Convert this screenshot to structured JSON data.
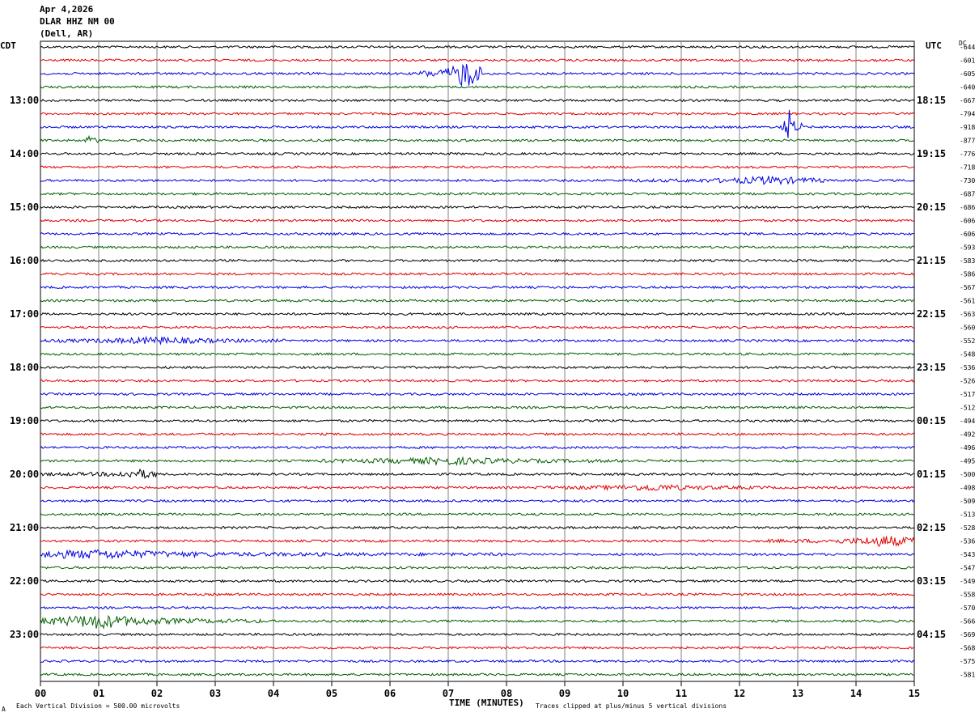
{
  "header": {
    "date": "Apr 4,2026",
    "station": "DLAR HHZ NM 00",
    "location": "(Dell, AR)"
  },
  "left_axis_label": "CDT",
  "right_axis_label": "UTC",
  "dc_label": "DC",
  "footer": {
    "x_axis_title": "TIME (MINUTES)",
    "scale_note": "Each Vertical Division =  500.00 microvolts",
    "clip_note": "Traces clipped at plus/minus 5 vertical divisions",
    "corner_mark": "A"
  },
  "colors": {
    "trace_cycle": [
      "#000000",
      "#e00000",
      "#0000e0",
      "#006000"
    ],
    "grid": "#808080"
  },
  "chart_data": {
    "type": "line",
    "title": "DLAR HHZ NM 00",
    "xlabel": "TIME (MINUTES)",
    "ylabel": "",
    "xlim": [
      0,
      15
    ],
    "x_ticks": [
      "00",
      "01",
      "02",
      "03",
      "04",
      "05",
      "06",
      "07",
      "08",
      "09",
      "10",
      "11",
      "12",
      "13",
      "14",
      "15"
    ],
    "left_hour_labels": [
      {
        "row": 4,
        "label": "13:00"
      },
      {
        "row": 8,
        "label": "14:00"
      },
      {
        "row": 12,
        "label": "15:00"
      },
      {
        "row": 16,
        "label": "16:00"
      },
      {
        "row": 20,
        "label": "17:00"
      },
      {
        "row": 24,
        "label": "18:00"
      },
      {
        "row": 28,
        "label": "19:00"
      },
      {
        "row": 32,
        "label": "20:00"
      },
      {
        "row": 36,
        "label": "21:00"
      },
      {
        "row": 40,
        "label": "22:00"
      },
      {
        "row": 44,
        "label": "23:00"
      }
    ],
    "right_hour_labels": [
      {
        "row": 4,
        "label": "18:15"
      },
      {
        "row": 8,
        "label": "19:15"
      },
      {
        "row": 12,
        "label": "20:15"
      },
      {
        "row": 16,
        "label": "21:15"
      },
      {
        "row": 20,
        "label": "22:15"
      },
      {
        "row": 24,
        "label": "23:15"
      },
      {
        "row": 28,
        "label": "00:15"
      },
      {
        "row": 32,
        "label": "01:15"
      },
      {
        "row": 36,
        "label": "02:15"
      },
      {
        "row": 40,
        "label": "03:15"
      },
      {
        "row": 44,
        "label": "04:15"
      }
    ],
    "dc_offsets": [
      "-644",
      "-601",
      "-605",
      "-640",
      "-667",
      "-794",
      "-918",
      "-877",
      "-776",
      "-718",
      "-730",
      "-687",
      "-686",
      "-606",
      "-606",
      "-593",
      "-583",
      "-586",
      "-567",
      "-561",
      "-563",
      "-560",
      "-552",
      "-548",
      "-536",
      "-526",
      "-517",
      "-512",
      "-494",
      "-492",
      "-496",
      "-495",
      "-500",
      "-498",
      "-509",
      "-513",
      "-528",
      "-536",
      "-543",
      "-547",
      "-549",
      "-558",
      "-570",
      "-566",
      "-569",
      "-568",
      "-575",
      "-581"
    ],
    "trace_count": 48,
    "trace_color_cycle": [
      "black",
      "red",
      "blue",
      "green"
    ],
    "events": [
      {
        "row": 2,
        "start_min": 6.5,
        "end_min": 7.6,
        "peak_min": 7.3,
        "amplitude": 1.8
      },
      {
        "row": 6,
        "start_min": 12.7,
        "end_min": 13.1,
        "peak_min": 12.85,
        "amplitude": 2.0
      },
      {
        "row": 7,
        "start_min": 0.75,
        "end_min": 1.1,
        "peak_min": 0.85,
        "amplitude": 0.5
      },
      {
        "row": 10,
        "start_min": 10.0,
        "end_min": 13.5,
        "peak_min": 12.5,
        "amplitude": 0.4
      },
      {
        "row": 22,
        "start_min": 0.0,
        "end_min": 4.2,
        "peak_min": 2.0,
        "amplitude": 0.35
      },
      {
        "row": 31,
        "start_min": 4.8,
        "end_min": 10.5,
        "peak_min": 7.0,
        "amplitude": 0.35
      },
      {
        "row": 32,
        "start_min": 0.0,
        "end_min": 2.0,
        "peak_min": 1.7,
        "amplitude": 0.45
      },
      {
        "row": 33,
        "start_min": 8.5,
        "end_min": 12.5,
        "peak_min": 10.5,
        "amplitude": 0.3
      },
      {
        "row": 37,
        "start_min": 12.5,
        "end_min": 15.0,
        "peak_min": 14.5,
        "amplitude": 0.6
      },
      {
        "row": 38,
        "start_min": 0.0,
        "end_min": 8.0,
        "peak_min": 1.0,
        "amplitude": 0.45
      },
      {
        "row": 43,
        "start_min": 0.0,
        "end_min": 3.8,
        "peak_min": 1.0,
        "amplitude": 0.8
      }
    ]
  }
}
